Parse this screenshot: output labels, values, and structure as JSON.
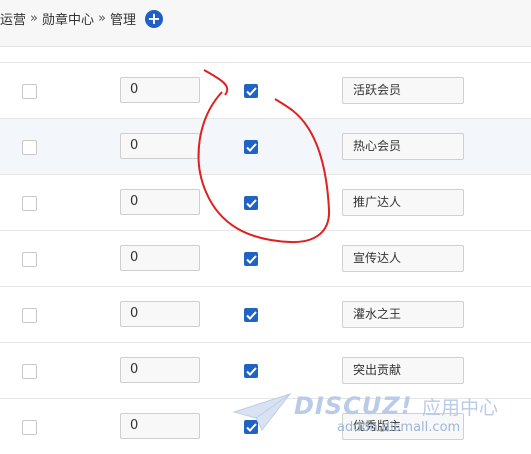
{
  "breadcrumb": {
    "items": [
      "运营",
      "勋章中心",
      "管理"
    ],
    "separator": "»"
  },
  "rows": [
    {
      "order": "0",
      "enabled": true,
      "name": "活跃会员"
    },
    {
      "order": "0",
      "enabled": true,
      "name": "热心会员"
    },
    {
      "order": "0",
      "enabled": true,
      "name": "推广达人"
    },
    {
      "order": "0",
      "enabled": true,
      "name": "宣传达人"
    },
    {
      "order": "0",
      "enabled": true,
      "name": "灌水之王"
    },
    {
      "order": "0",
      "enabled": true,
      "name": "突出贡献"
    },
    {
      "order": "0",
      "enabled": true,
      "name": "优秀版主"
    }
  ],
  "watermark": {
    "brand": "DISCUZ!",
    "brand_cn": "应用中心",
    "domain": "addon.dismall.com"
  },
  "colors": {
    "accent": "#1f63c4",
    "annotation": "#e0201e",
    "alt_row": "#f3f7fb"
  }
}
